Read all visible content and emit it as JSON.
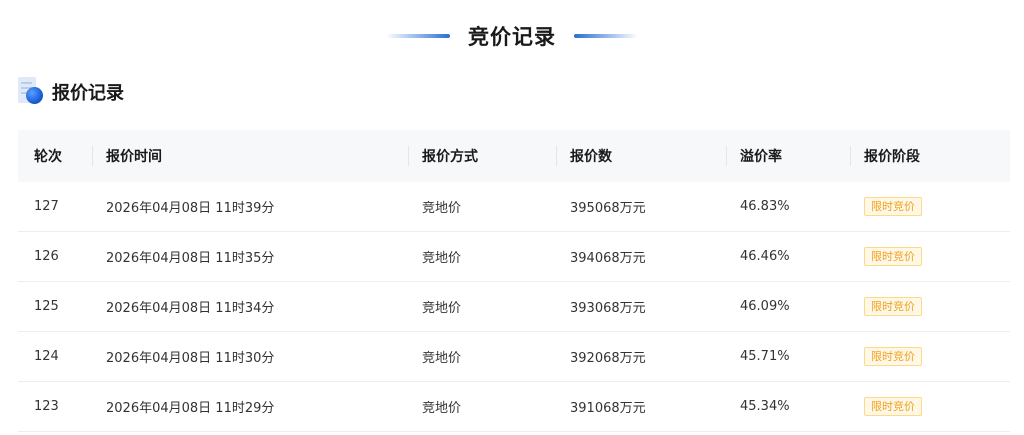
{
  "page": {
    "title": "竞价记录",
    "accent": "#2b6cd6"
  },
  "section": {
    "title": "报价记录",
    "icon": "document-globe-icon"
  },
  "table": {
    "headers": [
      "轮次",
      "报价时间",
      "报价方式",
      "报价数",
      "溢价率",
      "报价阶段"
    ],
    "rows": [
      {
        "round": "127",
        "time": "2026年04月08日 11时39分",
        "method": "竞地价",
        "amount": "395068万元",
        "premium": "46.83%",
        "stage": "限时竞价"
      },
      {
        "round": "126",
        "time": "2026年04月08日 11时35分",
        "method": "竞地价",
        "amount": "394068万元",
        "premium": "46.46%",
        "stage": "限时竞价"
      },
      {
        "round": "125",
        "time": "2026年04月08日 11时34分",
        "method": "竞地价",
        "amount": "393068万元",
        "premium": "46.09%",
        "stage": "限时竞价"
      },
      {
        "round": "124",
        "time": "2026年04月08日 11时30分",
        "method": "竞地价",
        "amount": "392068万元",
        "premium": "45.71%",
        "stage": "限时竞价"
      },
      {
        "round": "123",
        "time": "2026年04月08日 11时29分",
        "method": "竞地价",
        "amount": "391068万元",
        "premium": "45.34%",
        "stage": "限时竞价"
      }
    ],
    "stage_badge_color": "#f0a020"
  }
}
